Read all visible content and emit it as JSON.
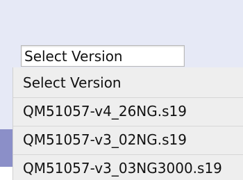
{
  "select": {
    "current_value": "Select Version"
  },
  "dropdown": {
    "options": [
      "Select Version",
      "QM51057-v4_26NG.s19",
      "QM51057-v3_02NG.s19",
      "QM51057-v3_03NG3000.s19"
    ]
  }
}
